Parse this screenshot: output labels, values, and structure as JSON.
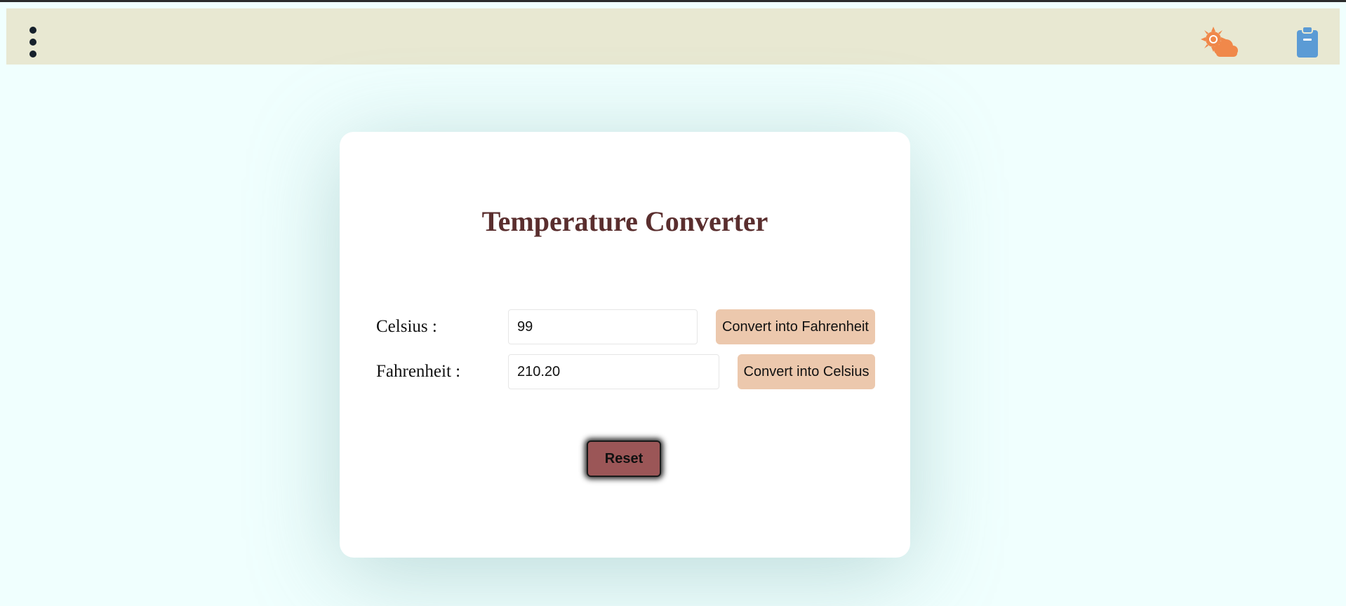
{
  "navbar": {
    "menu_icon": "three-dot-vertical-icon",
    "weather_icon": "sun-behind-cloud-icon",
    "clipboard_icon": "clipboard-minus-icon",
    "colors": {
      "background": "#e8e8d2",
      "weather_icon": "#f0884a",
      "clipboard_icon": "#5b9bd5"
    }
  },
  "converter": {
    "title": "Temperature Converter",
    "celsius": {
      "label": "Celsius :",
      "value": "99",
      "button_label": "Convert into Fahrenheit"
    },
    "fahrenheit": {
      "label": "Fahrenheit :",
      "value": "210.20",
      "button_label": "Convert into Celsius"
    },
    "reset_label": "Reset"
  },
  "colors": {
    "page_background": "#f0fffe",
    "title": "#5a2e2e",
    "convert_button": "#ecc8ad",
    "reset_button": "#9b5657"
  }
}
